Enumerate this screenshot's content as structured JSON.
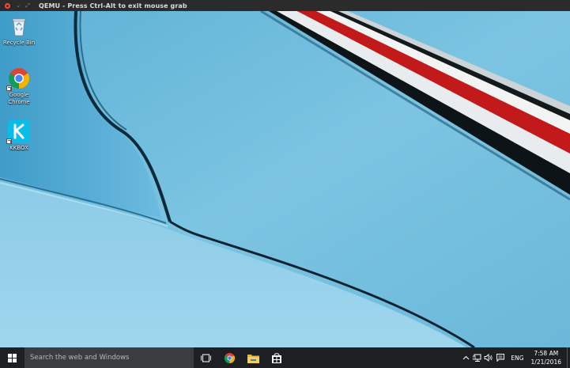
{
  "window": {
    "title": "QEMU - Press Ctrl-Alt to exit mouse grab"
  },
  "desktop": {
    "icons": [
      {
        "label": "Recycle Bin",
        "icon": "recycle-bin-icon"
      },
      {
        "label": "Google Chrome",
        "icon": "chrome-icon"
      },
      {
        "label": "KKBOX",
        "icon": "kkbox-icon"
      }
    ]
  },
  "taskbar": {
    "search_placeholder": "Search the web and Windows",
    "pinned": [
      {
        "name": "task-view",
        "icon": "task-view-icon"
      },
      {
        "name": "chrome",
        "icon": "chrome-icon"
      },
      {
        "name": "file-explorer",
        "icon": "folder-icon"
      },
      {
        "name": "store",
        "icon": "store-icon"
      }
    ],
    "tray": {
      "language": "ENG",
      "time": "7:58 AM",
      "date": "1/21/2016"
    }
  },
  "colors": {
    "wallpaper_blue": "#7cc4e0",
    "taskbar": "#1d1f23",
    "search_box": "#3a3c40",
    "stripe_red": "#c21a1a"
  }
}
